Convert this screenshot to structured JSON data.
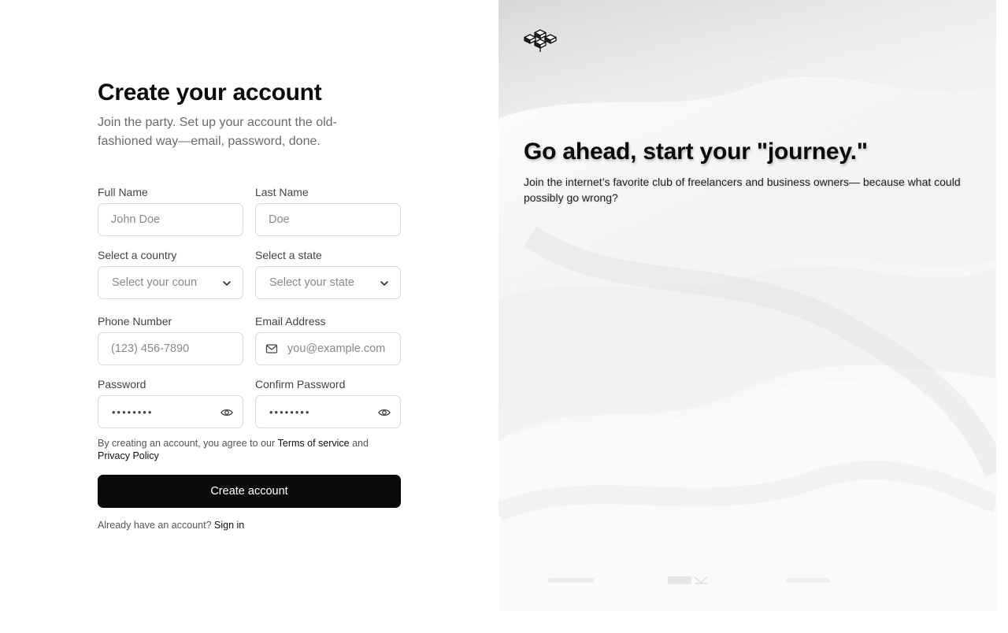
{
  "form": {
    "title": "Create your account",
    "subtitle": "Join the party. Set up your account the old-fashioned way—email, password, done.",
    "full_name": {
      "label": "Full Name",
      "placeholder": "John Doe"
    },
    "last_name": {
      "label": "Last Name",
      "placeholder": "Doe"
    },
    "country": {
      "label": "Select a country",
      "selected": "Select your country"
    },
    "state": {
      "label": "Select a state",
      "selected": "Select your state"
    },
    "phone": {
      "label": "Phone Number",
      "placeholder": "(123) 456-7890"
    },
    "email": {
      "label": "Email Address",
      "placeholder": "you@example.com"
    },
    "password": {
      "label": "Password",
      "value": "••••••••"
    },
    "confirm_password": {
      "label": "Confirm Password",
      "value": "••••••••"
    },
    "terms": {
      "prefix": "By creating an account, you agree to our ",
      "terms_link": "Terms of service",
      "and": " and",
      "privacy_link": "Privacy Policy"
    },
    "submit_label": "Create account",
    "signin": {
      "prefix": "Already have an account? ",
      "link": "Sign in"
    }
  },
  "hero": {
    "title": "Go ahead, start your \"journey.\"",
    "subtitle": "Join the internet’s favorite club of freelancers and business owners— because what could possibly go wrong?"
  },
  "icons": {
    "logo": "cubes-logo",
    "chevron": "chevron-down-icon",
    "mail": "mail-icon",
    "eye": "eye-icon"
  },
  "colors": {
    "button_bg": "#0a0a0a",
    "border": "#d9d9d9",
    "muted_text": "#6b6b6b"
  }
}
